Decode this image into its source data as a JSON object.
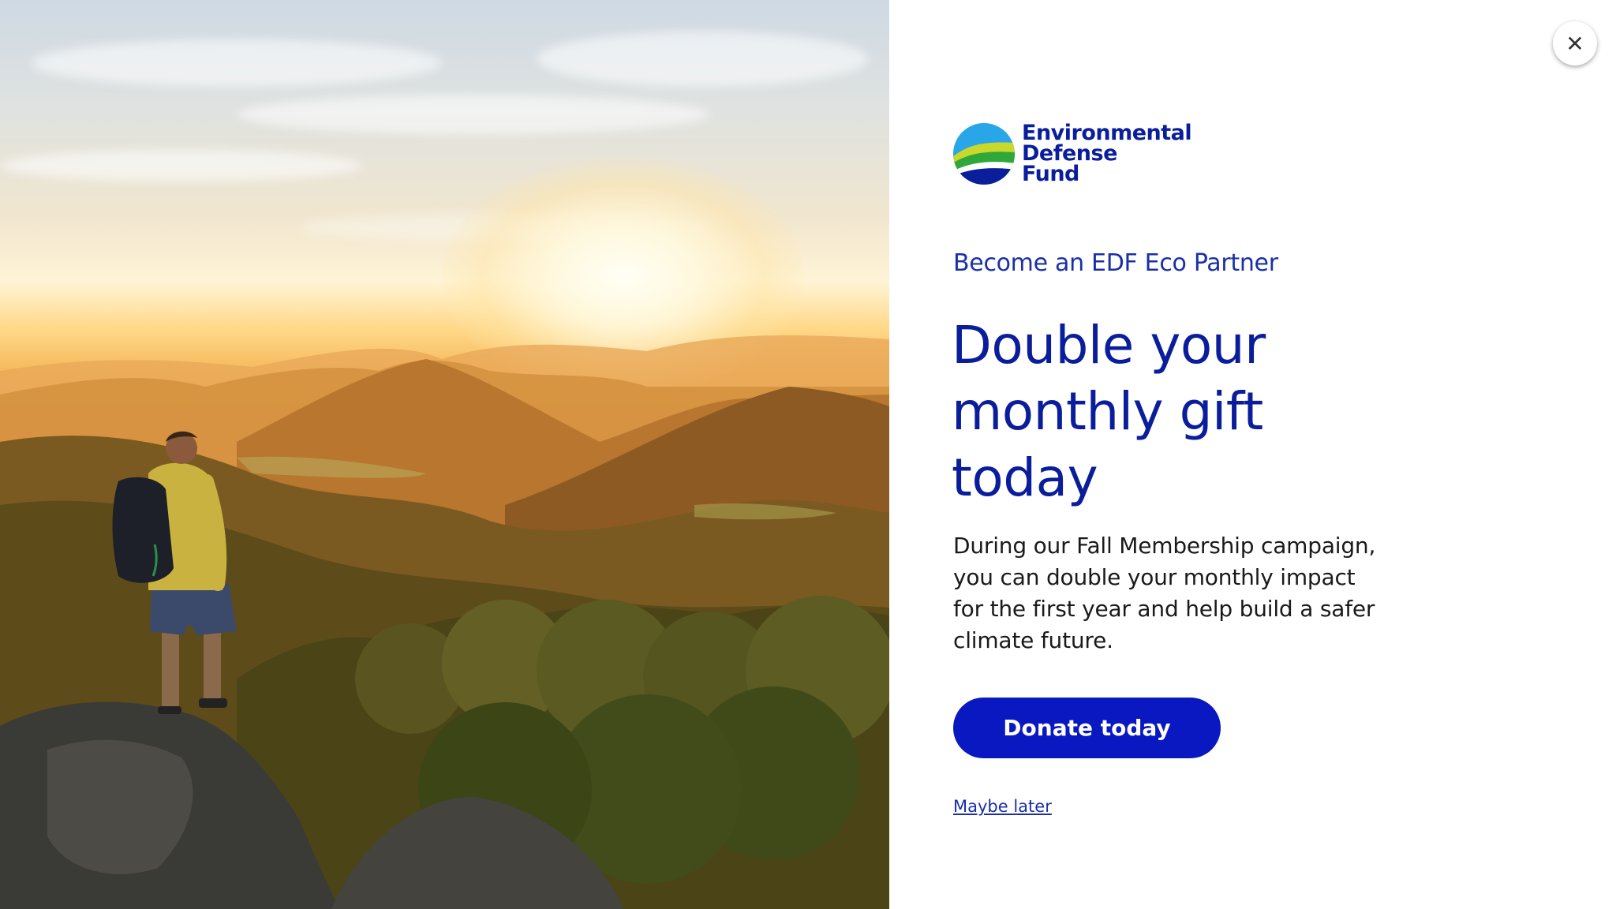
{
  "photo": {
    "icon": "hiker-landscape-photo",
    "description_alt": ""
  },
  "close": {
    "glyph": "✕",
    "icon": "close-icon"
  },
  "logo": {
    "line1": "Environmental",
    "line2": "Defense",
    "line3": "Fund",
    "icon": "edf-logo-icon"
  },
  "eyebrow": "Become an EDF Eco Partner",
  "headline": "Double your monthly gift today",
  "body": "During our Fall Membership campaign, you can double your monthly impact for the first year and help build a safer climate future.",
  "cta": {
    "donate_label": "Donate today",
    "maybe_later_label": "Maybe later"
  },
  "colors": {
    "brand_blue": "#0a1e9c",
    "button_blue": "#0a18c2",
    "text_dark": "#1a1a1a"
  }
}
